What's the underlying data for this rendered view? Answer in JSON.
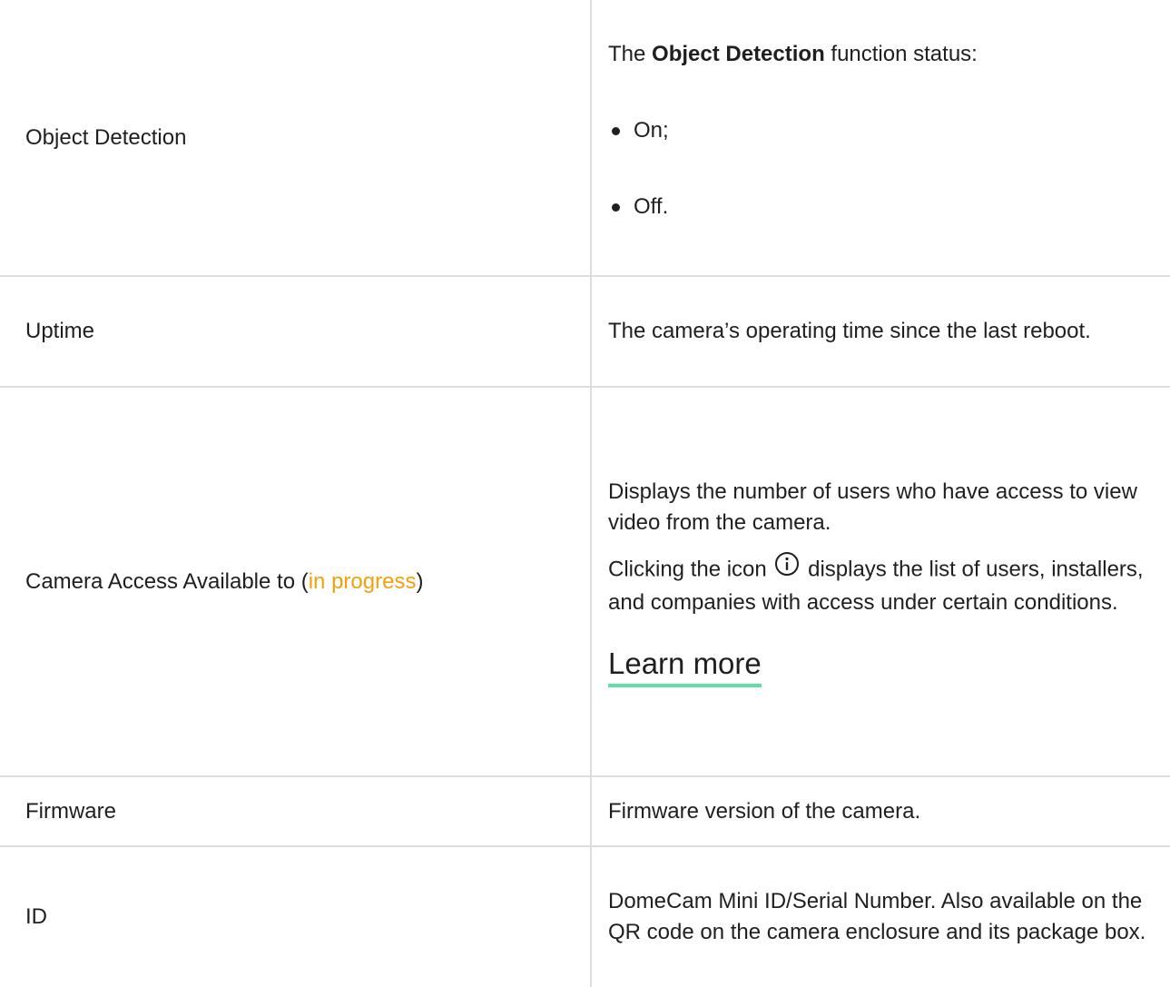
{
  "rows": [
    {
      "name": "Object Detection",
      "desc_prefix": "The ",
      "desc_bold": "Object Detection",
      "desc_suffix": " function status:",
      "options": [
        "On;",
        "Off."
      ]
    },
    {
      "name": "Uptime",
      "desc": "The camera’s operating time since the last reboot."
    },
    {
      "name_prefix": "Camera Access Available to (",
      "name_link": "in progress",
      "name_suffix": ")",
      "desc_p1": "Displays the number of users who have access to view video from the camera.",
      "desc_p2_prefix": "Clicking the icon ",
      "desc_p2_icon": "info-icon",
      "desc_p2_suffix": " displays the list of users, installers, and companies with access under certain conditions.",
      "learn_more": "Learn more"
    },
    {
      "name": "Firmware",
      "desc": "Firmware version of the camera."
    },
    {
      "name": "ID",
      "desc": "DomeCam Mini ID/Serial Number. Also available on the QR code on the camera enclosure and its package box."
    }
  ],
  "colors": {
    "border": "#dddddd",
    "link": "#f5a00a",
    "learn_more_underline": "#5fe0a3",
    "text": "#1f1f1f"
  }
}
